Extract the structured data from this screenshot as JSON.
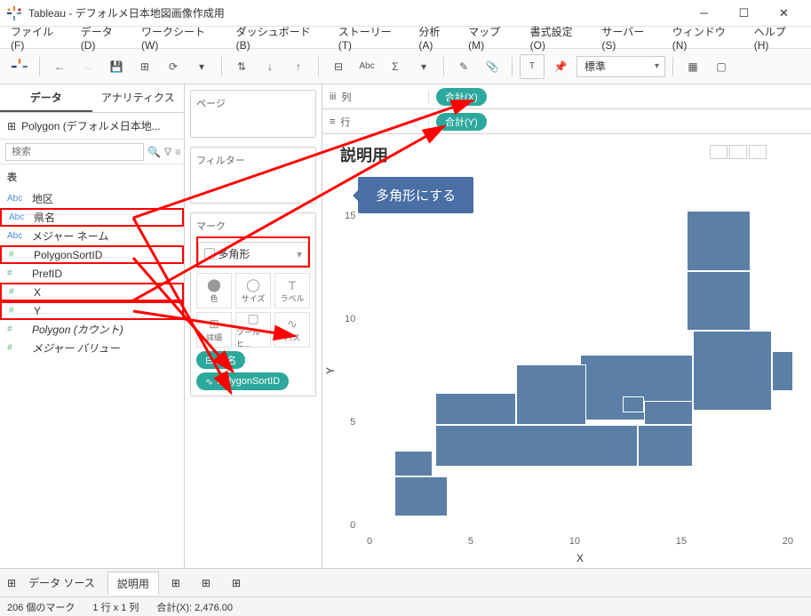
{
  "title": "Tableau - デフォルメ日本地図画像作成用",
  "menu": [
    "ファイル(F)",
    "データ(D)",
    "ワークシート(W)",
    "ダッシュボード(B)",
    "ストーリー(T)",
    "分析(A)",
    "マップ(M)",
    "書式設定(O)",
    "サーバー(S)",
    "ウィンドウ(N)",
    "ヘルプ(H)"
  ],
  "toolbar_combo": "標準",
  "side_tabs": {
    "data": "データ",
    "analytics": "アナリティクス"
  },
  "datasource": "Polygon (デフォルメ日本地...",
  "search_placeholder": "検索",
  "tables_label": "表",
  "fields": [
    {
      "type": "abc",
      "label": "地区",
      "hl": false
    },
    {
      "type": "abc",
      "label": "県名",
      "hl": true
    },
    {
      "type": "abc",
      "label": "メジャー ネーム",
      "hl": false
    },
    {
      "type": "num",
      "label": "PolygonSortID",
      "hl": true
    },
    {
      "type": "num",
      "label": "PrefID",
      "hl": false
    },
    {
      "type": "num",
      "label": "X",
      "hl": true
    },
    {
      "type": "num",
      "label": "Y",
      "hl": true
    },
    {
      "type": "num",
      "label": "Polygon (カウント)",
      "hl": false,
      "italic": true
    },
    {
      "type": "num",
      "label": "メジャー バリュー",
      "hl": false,
      "italic": true
    }
  ],
  "pages_label": "ページ",
  "filters_label": "フィルター",
  "marks_label": "マーク",
  "mark_type": "多角形",
  "mark_cells": [
    "色",
    "サイズ",
    "ラベル",
    "詳細",
    "ツールヒ...",
    "パス"
  ],
  "mark_pills": [
    {
      "label": "県名"
    },
    {
      "label": "PolygonSortID"
    }
  ],
  "columns_label": "列",
  "rows_label": "行",
  "col_pill": "合計(X)",
  "row_pill": "合計(Y)",
  "sheet_title": "説明用",
  "callout": "多角形にする",
  "chart_data": {
    "type": "scatter",
    "xlabel": "X",
    "ylabel": "Y",
    "xlim": [
      0,
      20
    ],
    "ylim": [
      0,
      16
    ],
    "xticks": [
      0,
      5,
      10,
      15,
      20
    ],
    "yticks": [
      0,
      5,
      10,
      15
    ],
    "polygons": [
      {
        "x": 15,
        "y": 13,
        "w": 3,
        "h": 3
      },
      {
        "x": 15,
        "y": 10,
        "w": 3,
        "h": 3
      },
      {
        "x": 15.3,
        "y": 6,
        "w": 3.7,
        "h": 4
      },
      {
        "x": 19,
        "y": 7,
        "w": 1,
        "h": 2
      },
      {
        "x": 10,
        "y": 5.5,
        "w": 5.3,
        "h": 3.3
      },
      {
        "x": 7,
        "y": 5.3,
        "w": 3.3,
        "h": 3
      },
      {
        "x": 3.2,
        "y": 3.2,
        "w": 9.5,
        "h": 2.1
      },
      {
        "x": 3.2,
        "y": 5.3,
        "w": 3.8,
        "h": 1.6
      },
      {
        "x": 12.7,
        "y": 3.2,
        "w": 2.6,
        "h": 2.1
      },
      {
        "x": 13,
        "y": 5.3,
        "w": 2.3,
        "h": 1.2
      },
      {
        "x": 12,
        "y": 5.9,
        "w": 1,
        "h": 0.8
      },
      {
        "x": 1.3,
        "y": 0.7,
        "w": 2.5,
        "h": 2
      },
      {
        "x": 1.3,
        "y": 2.7,
        "w": 1.8,
        "h": 1.3
      }
    ]
  },
  "bottom": {
    "datasource": "データ ソース",
    "sheet": "説明用"
  },
  "status": {
    "marks": "206 個のマーク",
    "grid": "1 行 x 1 列",
    "sum": "合計(X): 2,476.00"
  }
}
